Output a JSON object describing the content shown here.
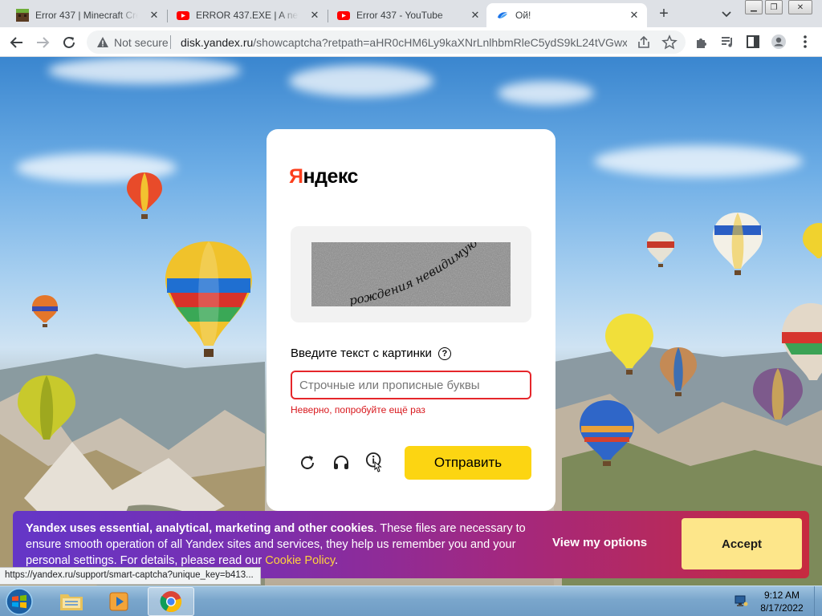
{
  "browser": {
    "tabs": [
      {
        "title": "Error 437 | Minecraft Cree",
        "favicon": "minecraft-icon",
        "active": false
      },
      {
        "title": "ERROR 437.EXE | A new v",
        "favicon": "youtube-icon",
        "active": false
      },
      {
        "title": "Error 437 - YouTube",
        "favicon": "youtube-icon",
        "active": false
      },
      {
        "title": "Ой!",
        "favicon": "yandex-disk-icon",
        "active": true
      }
    ],
    "security_label": "Not secure",
    "url_host": "disk.yandex.ru",
    "url_path": "/showcaptcha?retpath=aHR0cHM6Ly9kaXNrLnlhbmRleC5ydS9kL24tVGwx..."
  },
  "captcha": {
    "logo_first": "Я",
    "logo_rest": "ндекс",
    "captcha_text": "рождения невидимую",
    "prompt": "Введите текст с картинки",
    "help_glyph": "?",
    "input_value": "",
    "input_placeholder": "Строчные или прописные буквы",
    "error": "Неверно, попробуйте ещё раз",
    "submit_label": "Отправить"
  },
  "cookie_banner": {
    "lead": "Yandex uses essential, analytical, marketing and other cookies",
    "body": ". These files are necessary to ensure smooth operation of all Yandex sites and services, they help us remember you and your personal settings. For details, please read our ",
    "link": "Cookie Policy",
    "tail": ".",
    "options_label": "View my options",
    "accept_label": "Accept"
  },
  "status_bar": {
    "hover_url": "https://yandex.ru/support/smart-captcha?unique_key=b413..."
  },
  "taskbar": {
    "time": "9:12 AM",
    "date": "8/17/2022"
  },
  "colors": {
    "yandex_red": "#fc3f1d",
    "submit_yellow": "#fcd512",
    "error_red": "#d8171c",
    "cookie_link": "#ffd33c"
  }
}
